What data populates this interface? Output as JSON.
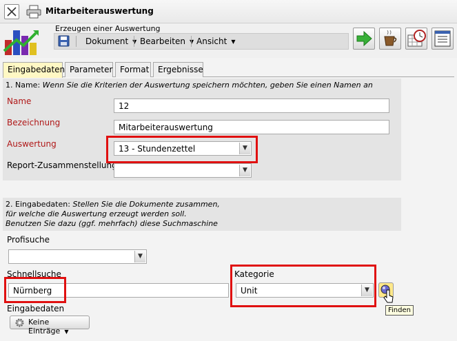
{
  "window": {
    "title": "Mitarbeiterauswertung"
  },
  "header": {
    "subtitle": "Erzeugen einer Auswertung",
    "menu": [
      "Dokument",
      "Bearbeiten",
      "Ansicht"
    ],
    "menu_arrow": "▼"
  },
  "tabs": [
    {
      "label": "Eingabedaten",
      "active": true
    },
    {
      "label": "Parameter"
    },
    {
      "label": "Format"
    },
    {
      "label": "Ergebnisse"
    }
  ],
  "section1": {
    "number": "1. Name:",
    "hint": "Wenn Sie die Kriterien der Auswertung speichern möchten, geben Sie einen Namen an",
    "name_label": "Name",
    "name_value": "12",
    "bezeichnung_label": "Bezeichnung",
    "bezeichnung_value": "Mitarbeiterauswertung",
    "auswertung_label": "Auswertung",
    "auswertung_value": "13 - Stundenzettel",
    "report_label": "Report-Zusammenstellung",
    "report_value": ""
  },
  "section2": {
    "number": "2. Eingabedaten:",
    "hint_line1": "Stellen Sie die Dokumente zusammen,",
    "hint_line2": "für welche die Auswertung erzeugt werden soll.",
    "hint_line3": "Benutzen Sie dazu (ggf. mehrfach) diese Suchmaschine",
    "profisuche_label": "Profisuche",
    "profisuche_value": "",
    "schnellsuche_label": "Schnellsuche",
    "schnellsuche_value": "Nürnberg",
    "kategorie_label": "Kategorie",
    "kategorie_value": "Unit",
    "find_tooltip": "Finden",
    "eingabedaten_label": "Eingabedaten",
    "keine_eintraege": "Keine Einträge"
  },
  "colors": {
    "highlight": "#e01010",
    "label_red": "#b01818",
    "active_tab": "#fff8c4"
  },
  "icons": [
    "close-icon",
    "print-icon",
    "app-logo",
    "save-icon",
    "arrow-right-icon",
    "coffee-icon",
    "calendar-clock-icon",
    "list-window-icon",
    "search-icon",
    "gear-icon"
  ]
}
